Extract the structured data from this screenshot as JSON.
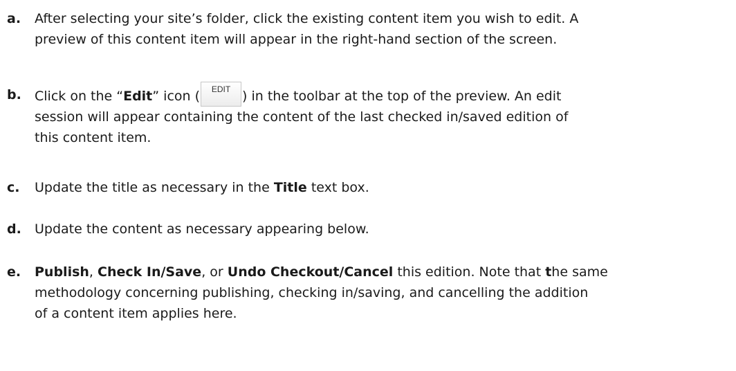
{
  "items": [
    {
      "marker": "a.",
      "lines": [
        "After selecting your site’s folder, click the existing content item you wish to edit. A",
        "preview of this content item will appear in the right-hand section of the screen."
      ]
    },
    {
      "marker": "b.",
      "line1_pre": "Click on the “",
      "line1_bold": "Edit",
      "line1_mid": "” icon (",
      "edit_button_label": "EDIT",
      "line1_post": ") in the toolbar at the top of the preview. An edit",
      "line2": "session will appear containing the content of the last checked in/saved edition of",
      "line3": "this content item."
    },
    {
      "marker": "c.",
      "pre": "Update the title as necessary in the ",
      "bold": "Title",
      "post": " text box."
    },
    {
      "marker": "d.",
      "text": "Update the content as necessary appearing below."
    },
    {
      "marker": "e.",
      "bold1": "Publish",
      "sep1": ", ",
      "bold2": "Check In/Save",
      "sep2": ", or ",
      "bold3": "Undo Checkout/Cancel",
      "mid": " this edition. Note that ",
      "bold4": "t",
      "post": "he same",
      "line2": "methodology concerning publishing, checking in/saving, and cancelling the addition",
      "line3": "of a content item applies here."
    }
  ]
}
